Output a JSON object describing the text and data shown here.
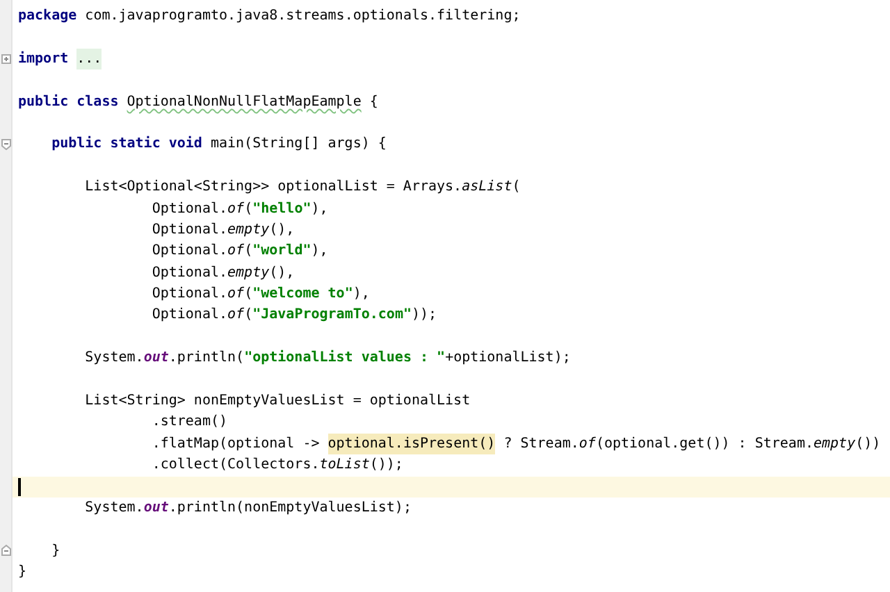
{
  "editor": {
    "lines": [
      {
        "kind": "code",
        "current": false,
        "tokens": [
          {
            "kind": "keyword",
            "text": "package"
          },
          {
            "kind": "plain",
            "text": " com.javaprogramto.java8.streams.optionals.filtering;"
          }
        ]
      },
      {
        "kind": "blank",
        "current": false
      },
      {
        "kind": "code",
        "current": false,
        "expanded": false,
        "tokens": [
          {
            "kind": "keyword",
            "text": "import"
          },
          {
            "kind": "folded",
            "text": "..."
          }
        ]
      },
      {
        "kind": "blank",
        "current": false
      },
      {
        "kind": "block",
        "current": false,
        "tokens": [
          {
            "kind": "keyword",
            "text": "public class"
          },
          {
            "kind": "typo",
            "text": "OptionalNonNullFlatMapEample"
          },
          {
            "kind": "plain",
            "text": " {"
          }
        ],
        "children": [
          {
            "kind": "blank",
            "current": false
          },
          {
            "kind": "block",
            "current": false,
            "expanded": true,
            "tokens": [
              {
                "kind": "keyword",
                "text": "public static void"
              },
              {
                "kind": "plain",
                "text": " main(String[] args) {"
              }
            ],
            "children": [
              {
                "kind": "blank",
                "current": false
              },
              {
                "kind": "statement",
                "current": false,
                "tokens": [
                  {
                    "kind": "plain",
                    "text": "List<Optional<String>> optionalList = Arrays."
                  },
                  {
                    "kind": "static",
                    "text": "asList"
                  },
                  {
                    "kind": "plain",
                    "text": "("
                  }
                ],
                "children": [
                  {
                    "kind": "code",
                    "current": false,
                    "tokens": [
                      {
                        "kind": "plain",
                        "text": "Optional."
                      },
                      {
                        "kind": "static",
                        "text": "of"
                      },
                      {
                        "kind": "plain",
                        "text": "("
                      },
                      {
                        "kind": "string",
                        "text": "\"hello\""
                      },
                      {
                        "kind": "plain",
                        "text": "),"
                      }
                    ]
                  },
                  {
                    "kind": "code",
                    "current": false,
                    "tokens": [
                      {
                        "kind": "plain",
                        "text": "Optional."
                      },
                      {
                        "kind": "static",
                        "text": "empty"
                      },
                      {
                        "kind": "plain",
                        "text": "(),"
                      }
                    ]
                  },
                  {
                    "kind": "code",
                    "current": false,
                    "tokens": [
                      {
                        "kind": "plain",
                        "text": "Optional."
                      },
                      {
                        "kind": "static",
                        "text": "of"
                      },
                      {
                        "kind": "plain",
                        "text": "("
                      },
                      {
                        "kind": "string",
                        "text": "\"world\""
                      },
                      {
                        "kind": "plain",
                        "text": "),"
                      }
                    ]
                  },
                  {
                    "kind": "code",
                    "current": false,
                    "tokens": [
                      {
                        "kind": "plain",
                        "text": "Optional."
                      },
                      {
                        "kind": "static",
                        "text": "empty"
                      },
                      {
                        "kind": "plain",
                        "text": "(),"
                      }
                    ]
                  },
                  {
                    "kind": "code",
                    "current": false,
                    "tokens": [
                      {
                        "kind": "plain",
                        "text": "Optional."
                      },
                      {
                        "kind": "static",
                        "text": "of"
                      },
                      {
                        "kind": "plain",
                        "text": "("
                      },
                      {
                        "kind": "string",
                        "text": "\"welcome to\""
                      },
                      {
                        "kind": "plain",
                        "text": "),"
                      }
                    ]
                  },
                  {
                    "kind": "code",
                    "current": false,
                    "tokens": [
                      {
                        "kind": "plain",
                        "text": "Optional."
                      },
                      {
                        "kind": "static",
                        "text": "of"
                      },
                      {
                        "kind": "plain",
                        "text": "("
                      },
                      {
                        "kind": "string",
                        "text": "\"JavaProgramTo.com\""
                      },
                      {
                        "kind": "plain",
                        "text": "));"
                      }
                    ]
                  }
                ]
              },
              {
                "kind": "blank",
                "current": false
              },
              {
                "kind": "code",
                "current": false,
                "tokens": [
                  {
                    "kind": "plain",
                    "text": "System."
                  },
                  {
                    "kind": "field",
                    "text": "out"
                  },
                  {
                    "kind": "plain",
                    "text": ".println("
                  },
                  {
                    "kind": "string",
                    "text": "\"optionalList values : \""
                  },
                  {
                    "kind": "plain",
                    "text": "+optionalList);"
                  }
                ]
              },
              {
                "kind": "blank",
                "current": false
              },
              {
                "kind": "statement",
                "current": false,
                "tokens": [
                  {
                    "kind": "plain",
                    "text": "List<String> nonEmptyValuesList = optionalList"
                  }
                ],
                "children": [
                  {
                    "kind": "code",
                    "current": false,
                    "tokens": [
                      {
                        "kind": "plain",
                        "text": ".stream()"
                      }
                    ]
                  },
                  {
                    "kind": "code",
                    "current": false,
                    "tokens": [
                      {
                        "kind": "plain",
                        "text": ".flatMap(optional -> "
                      },
                      {
                        "kind": "highlight",
                        "text": "optional.isPresent()"
                      },
                      {
                        "kind": "plain",
                        "text": " ? Stream."
                      },
                      {
                        "kind": "static",
                        "text": "of"
                      },
                      {
                        "kind": "plain",
                        "text": "(optional.get()) : Stream."
                      },
                      {
                        "kind": "static",
                        "text": "empty"
                      },
                      {
                        "kind": "plain",
                        "text": "())"
                      }
                    ]
                  },
                  {
                    "kind": "code",
                    "current": false,
                    "tokens": [
                      {
                        "kind": "plain",
                        "text": ".collect(Collectors."
                      },
                      {
                        "kind": "static",
                        "text": "toList"
                      },
                      {
                        "kind": "plain",
                        "text": "());"
                      }
                    ]
                  }
                ]
              },
              {
                "kind": "blank",
                "current": true
              },
              {
                "kind": "code",
                "current": false,
                "tokens": [
                  {
                    "kind": "plain",
                    "text": "System."
                  },
                  {
                    "kind": "field",
                    "text": "out"
                  },
                  {
                    "kind": "plain",
                    "text": ".println(nonEmptyValuesList);"
                  }
                ]
              },
              {
                "kind": "blank",
                "current": false
              }
            ]
          },
          {
            "kind": "close",
            "current": false,
            "tokens": [
              {
                "kind": "plain",
                "text": "}"
              }
            ]
          }
        ]
      },
      {
        "kind": "close",
        "current": false,
        "tokens": [
          {
            "kind": "plain",
            "text": "}"
          }
        ]
      }
    ]
  }
}
